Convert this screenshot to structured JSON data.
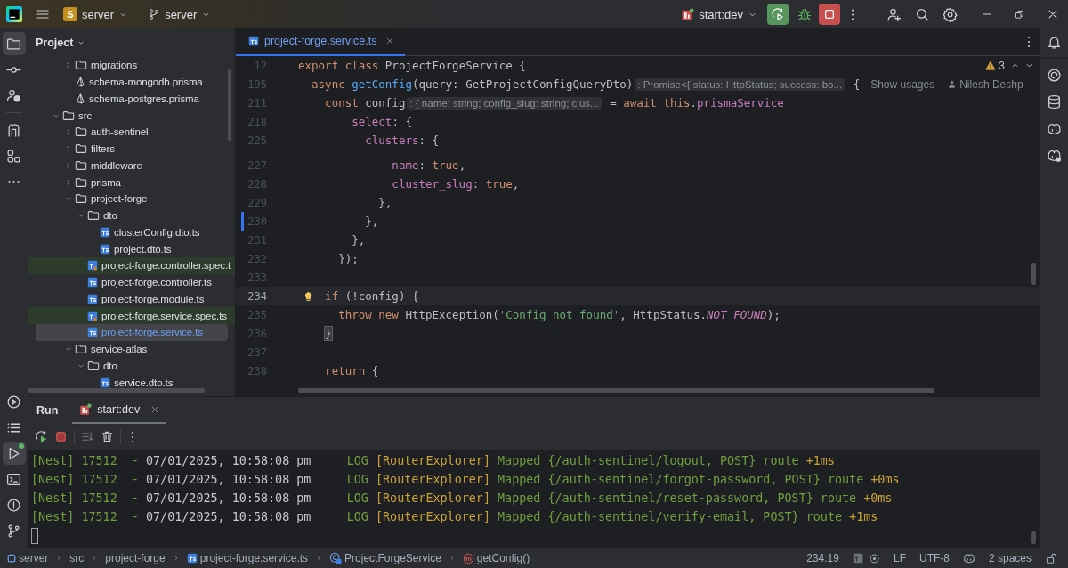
{
  "title_bar": {
    "project": {
      "badge": "S",
      "name": "server"
    },
    "branch": "server",
    "run_config": "start:dev"
  },
  "left_toolbar": {
    "top": [
      {
        "selected": true
      },
      {
        "selected": false
      },
      {
        "selected": false
      },
      {
        "selected": false
      },
      {
        "selected": false
      },
      {
        "selected": false
      }
    ],
    "bottom": [
      {
        "selected": false
      },
      {
        "selected": false
      },
      {
        "selected": true
      },
      {
        "selected": false
      },
      {
        "selected": false
      },
      {
        "selected": false
      }
    ]
  },
  "project_panel": {
    "title": "Project",
    "tree": [
      {
        "children": [
          {
            "name": "migrations",
            "kind": "folder",
            "expanded": false,
            "selected": false,
            "added": false
          },
          {
            "name": "schema-mongodb.prisma",
            "kind": "prisma",
            "selected": false,
            "added": false
          },
          {
            "name": "schema-postgres.prisma",
            "kind": "prisma",
            "selected": false,
            "added": false
          }
        ]
      },
      {
        "name": "src",
        "kind": "folder",
        "expanded": true,
        "selected": false,
        "added": false,
        "children": [
          {
            "name": "auth-sentinel",
            "kind": "folder",
            "expanded": false,
            "selected": false,
            "added": false
          },
          {
            "name": "filters",
            "kind": "folder",
            "expanded": false,
            "selected": false,
            "added": false
          },
          {
            "name": "middleware",
            "kind": "folder",
            "expanded": false,
            "selected": false,
            "added": false
          },
          {
            "name": "prisma",
            "kind": "folder",
            "expanded": false,
            "selected": false,
            "added": false
          },
          {
            "name": "project-forge",
            "kind": "folder",
            "expanded": true,
            "selected": false,
            "added": false,
            "children": [
              {
                "name": "dto",
                "kind": "folder",
                "expanded": true,
                "selected": false,
                "added": false,
                "children": [
                  {
                    "name": "clusterConfig.dto.ts",
                    "kind": "ts",
                    "selected": false,
                    "added": false
                  },
                  {
                    "name": "project.dto.ts",
                    "kind": "ts",
                    "selected": false,
                    "added": false
                  }
                ]
              },
              {
                "name": "project-forge.controller.spec.t",
                "kind": "spec",
                "selected": false,
                "added": true
              },
              {
                "name": "project-forge.controller.ts",
                "kind": "ts",
                "selected": false,
                "added": false
              },
              {
                "name": "project-forge.module.ts",
                "kind": "ts",
                "selected": false,
                "added": false
              },
              {
                "name": "project-forge.service.spec.ts",
                "kind": "spec",
                "selected": false,
                "added": true
              },
              {
                "name": "project-forge.service.ts",
                "kind": "ts",
                "selected": true,
                "added": false
              }
            ]
          },
          {
            "name": "service-atlas",
            "kind": "folder",
            "expanded": true,
            "selected": false,
            "added": false,
            "children": [
              {
                "name": "dto",
                "kind": "folder",
                "expanded": true,
                "selected": false,
                "added": false,
                "children": [
                  {
                    "name": "service.dto.ts",
                    "kind": "ts",
                    "selected": false,
                    "added": false
                  }
                ]
              }
            ]
          }
        ]
      }
    ]
  },
  "editor": {
    "tabs": [
      {
        "label": "project-forge.service.ts",
        "selected": true
      }
    ],
    "sticky_lines": [
      {
        "number": "12",
        "problems": "3",
        "tokens": [
          {
            "text": "export class ",
            "kind": "kw"
          },
          {
            "text": "ProjectForgeService {",
            "kind": "plain"
          }
        ]
      },
      {
        "number": "195",
        "usages": "Show usages",
        "author": "Nilesh Deshp",
        "tokens": [
          {
            "text": "  async ",
            "kind": "kw"
          },
          {
            "text": "getConfig",
            "kind": "fn"
          },
          {
            "text": "(query: GetProjectConfigQueryDto)",
            "kind": "plain"
          },
          {
            "text": ": Promise<{ status: HttpStatus; success: bo...",
            "kind": "hint"
          },
          {
            "text": " {",
            "kind": "plain"
          }
        ]
      },
      {
        "number": "211",
        "tokens": [
          {
            "text": "    const ",
            "kind": "kw"
          },
          {
            "text": "config",
            "kind": "plain"
          },
          {
            "text": ": { name: string; config_slug: string; clus...",
            "kind": "hint"
          },
          {
            "text": " = ",
            "kind": "plain"
          },
          {
            "text": "await this",
            "kind": "kw"
          },
          {
            "text": ".",
            "kind": "plain"
          },
          {
            "text": "prismaService",
            "kind": "prop"
          }
        ]
      },
      {
        "number": "218",
        "tokens": [
          {
            "text": "        select",
            "kind": "prop"
          },
          {
            "text": ": {",
            "kind": "plain"
          }
        ]
      },
      {
        "number": "225",
        "tokens": [
          {
            "text": "          clusters",
            "kind": "prop"
          },
          {
            "text": ": {",
            "kind": "plain"
          }
        ]
      }
    ],
    "lines": [
      {
        "number": "227",
        "current": false,
        "changed": false,
        "tokens": [
          {
            "text": "              name",
            "kind": "prop"
          },
          {
            "text": ": ",
            "kind": "plain"
          },
          {
            "text": "true",
            "kind": "kw"
          },
          {
            "text": ",",
            "kind": "plain"
          }
        ]
      },
      {
        "number": "228",
        "current": false,
        "changed": false,
        "tokens": [
          {
            "text": "              cluster_slug",
            "kind": "prop"
          },
          {
            "text": ": ",
            "kind": "plain"
          },
          {
            "text": "true",
            "kind": "kw"
          },
          {
            "text": ",",
            "kind": "plain"
          }
        ]
      },
      {
        "number": "229",
        "current": false,
        "changed": false,
        "tokens": [
          {
            "text": "            },",
            "kind": "plain"
          }
        ]
      },
      {
        "number": "230",
        "current": false,
        "changed": true,
        "tokens": [
          {
            "text": "          },",
            "kind": "plain"
          }
        ]
      },
      {
        "number": "231",
        "current": false,
        "changed": false,
        "tokens": [
          {
            "text": "        },",
            "kind": "plain"
          }
        ]
      },
      {
        "number": "232",
        "current": false,
        "changed": false,
        "tokens": [
          {
            "text": "      });",
            "kind": "plain"
          }
        ]
      },
      {
        "number": "233",
        "current": false,
        "changed": false
      },
      {
        "number": "234",
        "current": true,
        "changed": false,
        "tokens": [
          {
            "text": "    if ",
            "kind": "kw"
          },
          {
            "text": "(!config) {",
            "kind": "plain"
          }
        ]
      },
      {
        "number": "235",
        "current": false,
        "changed": false,
        "tokens": [
          {
            "text": "      throw new ",
            "kind": "kw"
          },
          {
            "text": "HttpException(",
            "kind": "plain"
          },
          {
            "text": "'Config not found'",
            "kind": "str"
          },
          {
            "text": ", HttpStatus.",
            "kind": "plain"
          },
          {
            "text": "NOT_FOUND",
            "kind": "const"
          },
          {
            "text": ");",
            "kind": "plain"
          }
        ]
      },
      {
        "number": "236",
        "current": false,
        "changed": false,
        "tokens": [
          {
            "text": "    }",
            "kind": "brace"
          }
        ]
      },
      {
        "number": "237",
        "current": false,
        "changed": false
      },
      {
        "number": "238",
        "current": false,
        "changed": false,
        "tokens": [
          {
            "text": "    return ",
            "kind": "kw"
          },
          {
            "text": "{",
            "kind": "plain"
          }
        ]
      }
    ]
  },
  "run_panel": {
    "title": "Run",
    "tabs": [
      {
        "label": "start:dev",
        "selected": true
      }
    ],
    "console": [
      [
        {
          "text": "[Nest] 17512  - ",
          "kind": "green"
        },
        {
          "text": "07/01/2025, 10:58:08 pm     ",
          "kind": "plain"
        },
        {
          "text": "LOG ",
          "kind": "green"
        },
        {
          "text": "[RouterExplorer] ",
          "kind": "yellow"
        },
        {
          "text": "Mapped {/auth-sentinel/logout, POST} route ",
          "kind": "green"
        },
        {
          "text": "+1ms",
          "kind": "yellow"
        }
      ],
      [
        {
          "text": "[Nest] 17512  - ",
          "kind": "green"
        },
        {
          "text": "07/01/2025, 10:58:08 pm     ",
          "kind": "plain"
        },
        {
          "text": "LOG ",
          "kind": "green"
        },
        {
          "text": "[RouterExplorer] ",
          "kind": "yellow"
        },
        {
          "text": "Mapped {/auth-sentinel/forgot-password, POST} route ",
          "kind": "green"
        },
        {
          "text": "+0ms",
          "kind": "yellow"
        }
      ],
      [
        {
          "text": "[Nest] 17512  - ",
          "kind": "green"
        },
        {
          "text": "07/01/2025, 10:58:08 pm     ",
          "kind": "plain"
        },
        {
          "text": "LOG ",
          "kind": "green"
        },
        {
          "text": "[RouterExplorer] ",
          "kind": "yellow"
        },
        {
          "text": "Mapped {/auth-sentinel/reset-password, POST} route ",
          "kind": "green"
        },
        {
          "text": "+0ms",
          "kind": "yellow"
        }
      ],
      [
        {
          "text": "[Nest] 17512  - ",
          "kind": "green"
        },
        {
          "text": "07/01/2025, 10:58:08 pm     ",
          "kind": "plain"
        },
        {
          "text": "LOG ",
          "kind": "green"
        },
        {
          "text": "[RouterExplorer] ",
          "kind": "yellow"
        },
        {
          "text": "Mapped {/auth-sentinel/verify-email, POST} route ",
          "kind": "green"
        },
        {
          "text": "+1ms",
          "kind": "yellow"
        }
      ]
    ]
  },
  "status_bar": {
    "breadcrumbs": [
      {
        "label": "server",
        "kind": "module"
      },
      {
        "label": "src",
        "kind": "folder"
      },
      {
        "label": "project-forge",
        "kind": "folder"
      },
      {
        "label": "project-forge.service.ts",
        "kind": "ts"
      },
      {
        "label": "ProjectForgeService",
        "kind": "class"
      },
      {
        "label": "getConfig()",
        "kind": "method"
      }
    ],
    "position": "234:19",
    "line_separator": "LF",
    "encoding": "UTF-8",
    "indent": "2 spaces"
  }
}
